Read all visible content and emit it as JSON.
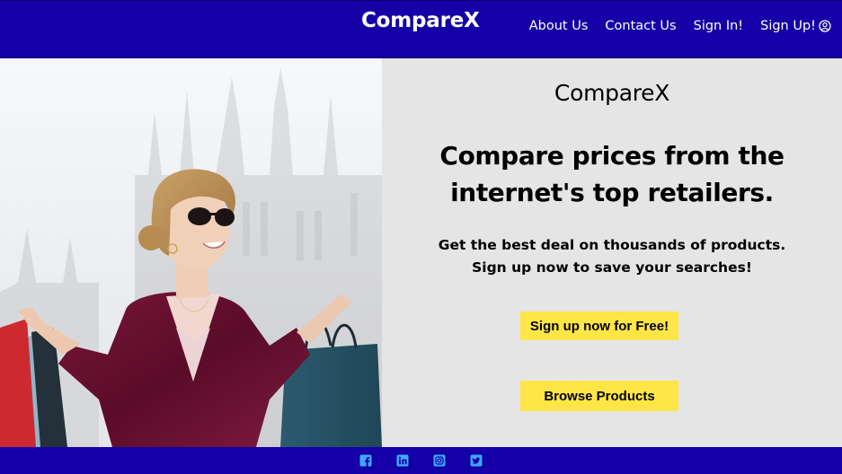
{
  "navbar": {
    "brand": "CompareX",
    "links": [
      {
        "label": "About Us"
      },
      {
        "label": "Contact Us"
      },
      {
        "label": "Sign In!"
      },
      {
        "label": "Sign Up!",
        "icon": "user-circle-icon"
      }
    ]
  },
  "hero": {
    "image": "woman-with-shopping-bags-photo",
    "panel": {
      "brand": "CompareX",
      "headline_lines": [
        "Compare prices from the",
        "internet's top retailers."
      ],
      "subtext_lines": [
        "Get the best deal on thousands of products.",
        "Sign up now to save your searches!"
      ],
      "signup_button": "Sign up now for Free!",
      "browse_button": "Browse Products"
    }
  },
  "footer": {
    "social_icons": [
      "facebook-icon",
      "linkedin-icon",
      "instagram-icon",
      "twitter-icon"
    ]
  },
  "colors": {
    "brand_blue": "#1400a6",
    "panel_gray": "#e5e5e5",
    "button_yellow": "#ffe647",
    "social_icon": "#3ea8ff"
  }
}
